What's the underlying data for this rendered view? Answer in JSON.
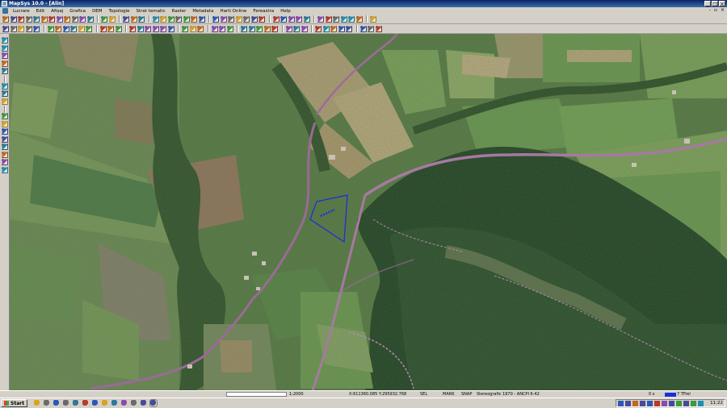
{
  "window": {
    "title": "MapSys 10.0 - [Alin]"
  },
  "window_controls": [
    "_",
    "□",
    "×"
  ],
  "mdi_controls": [
    "-",
    "▫",
    "×"
  ],
  "menu": [
    "Lucrare",
    "Edit",
    "Afișaj",
    "Grafica",
    "DEM",
    "Topologie",
    "Strat tematic",
    "Raster",
    "Metadata",
    "Harti Online",
    "Fereastra",
    "Help"
  ],
  "colors": {
    "title_gradient_start": "#0a246a",
    "title_gradient_end": "#3a6ea5",
    "chrome": "#d4d0c8",
    "parcel_outline": "#1f2fd8",
    "road": "#a06a9a",
    "progress": "#1a2fd8"
  },
  "toolbar1": {
    "icons": [
      "new-file-icon",
      "open-icon",
      "save-icon",
      "print-icon",
      "print-preview-icon",
      "cut-icon",
      "copy-icon",
      "paste-icon",
      "delete-icon",
      "open-folder-icon",
      "properties-icon",
      "export-icon",
      "sep",
      "undo-icon",
      "redo-icon",
      "sep",
      "cut-icon",
      "copy-icon",
      "paste-icon",
      "sep",
      "zoom-in-icon",
      "zoom-out-icon",
      "zoom-extent-icon",
      "pan-icon",
      "measure-icon",
      "attribute-icon",
      "info-icon",
      "sep",
      "select-icon",
      "select-rect-icon",
      "select-poly-icon",
      "deselect-icon",
      "layer-icon",
      "raster-icon",
      "grid-icon",
      "sep",
      "snap-icon",
      "snap-end-icon",
      "snap-mid-icon",
      "snap-center-icon",
      "circle-icon",
      "sep",
      "node-icon",
      "edit-icon",
      "split-icon",
      "merge-icon",
      "topology-icon",
      "check-icon",
      "sep",
      "layers-icon"
    ]
  },
  "toolbar2": {
    "icons": [
      "pointer-icon",
      "node-select-icon",
      "move-icon",
      "rotate-icon",
      "scale-icon",
      "sep",
      "line-icon",
      "polyline-icon",
      "polygon-icon",
      "rectangle-icon",
      "circle-icon",
      "arc-icon",
      "sep",
      "text-icon",
      "symbol-icon",
      "measure-icon",
      "sep",
      "parallel-icon",
      "offset-icon",
      "trim-icon",
      "extend-icon",
      "break-icon",
      "join-icon",
      "sep",
      "label-icon",
      "dimension-icon",
      "area-icon",
      "sep",
      "hatch-icon",
      "fill-icon",
      "color-icon",
      "sep",
      "fence-icon",
      "perpendicular-icon",
      "intersect-icon",
      "tangent-icon",
      "bisect-icon",
      "sep",
      "snap-grid-icon",
      "ortho-icon",
      "polar-icon",
      "sep",
      "coord-icon",
      "zoom-window-icon",
      "redraw-icon",
      "settings-icon",
      "tools-icon",
      "sep",
      "fence-line-icon",
      "measure-line-icon",
      "stack-icon"
    ]
  },
  "left_toolbar": {
    "icons": [
      "select-tool-icon",
      "layer-tool-icon",
      "layer-tool-icon",
      "layer-tool-icon",
      "layer-tool-icon",
      "sep",
      "attribute-tool-icon",
      "table-tool-icon",
      "query-tool-icon",
      "sep",
      "edit-tool-icon",
      "edit-tool-icon",
      "edit-tool-icon",
      "edit-tool-icon",
      "edit-tool-icon",
      "edit-tool-icon",
      "edit-tool-icon",
      "edit-tool-icon"
    ]
  },
  "statusbar": {
    "scale": "1:2000",
    "coords": "X:611360.085 Y:295932.768",
    "m1": "SEL",
    "m2": "MARK",
    "m3": "SNAP",
    "projection": "Stereografic 1970 - ANCPI 6-42",
    "count": "0 s",
    "total": "7 TFrel"
  },
  "taskbar": {
    "start_label": "Start",
    "clock": "11:22",
    "task_icons": [
      "explorer-icon",
      "ie-icon",
      "email-icon",
      "folder-icon",
      "word-icon",
      "excel-icon",
      "pdf-icon",
      "firefox-icon",
      "chrome-icon",
      "skype-icon",
      "media-icon",
      "image-icon",
      "mapsys-icon"
    ],
    "tray_icons": [
      "network-icon",
      "antivirus-icon",
      "sound-icon",
      "update-icon",
      "chat-icon",
      "battery-icon",
      "display-icon",
      "power-icon",
      "lang-icon",
      "shield-icon",
      "tray-icon",
      "speaker-icon"
    ]
  }
}
